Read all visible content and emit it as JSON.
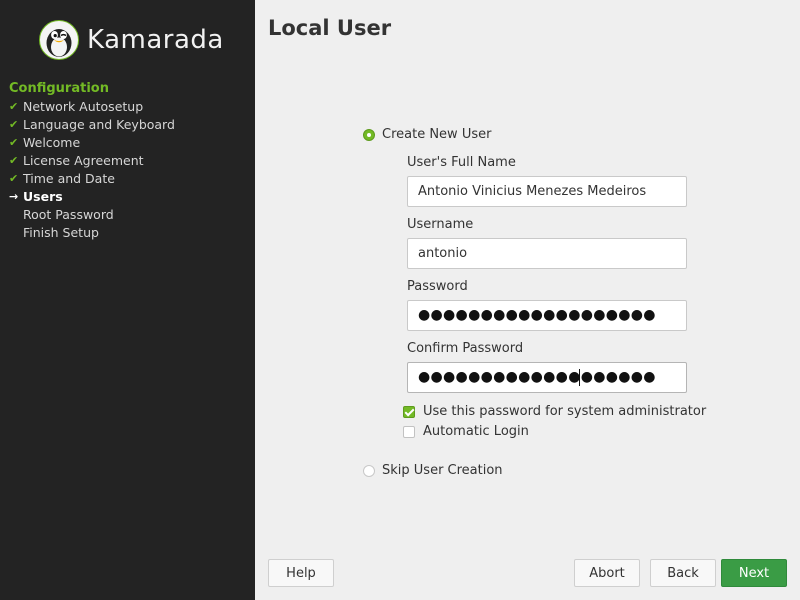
{
  "brand": {
    "name": "Kamarada"
  },
  "sidebar": {
    "title": "Configuration",
    "steps": [
      {
        "label": "Network Autosetup",
        "state": "done"
      },
      {
        "label": "Language and Keyboard",
        "state": "done"
      },
      {
        "label": "Welcome",
        "state": "done"
      },
      {
        "label": "License Agreement",
        "state": "done"
      },
      {
        "label": "Time and Date",
        "state": "done"
      },
      {
        "label": "Users",
        "state": "current"
      },
      {
        "label": "Root Password",
        "state": "pending"
      },
      {
        "label": "Finish Setup",
        "state": "pending"
      }
    ],
    "marks": {
      "done": "✔",
      "current": "→",
      "pending": ""
    }
  },
  "main": {
    "title": "Local User",
    "create_option": {
      "label": "Create New User",
      "selected": true
    },
    "fields": {
      "full_name": {
        "label": "User's Full Name",
        "value": "Antonio Vinicius Menezes Medeiros"
      },
      "username": {
        "label": "Username",
        "value": "antonio"
      },
      "password": {
        "label": "Password",
        "masked": "●●●●●●●●●●●●●●●●●●●"
      },
      "confirm_password": {
        "label": "Confirm Password",
        "masked": "●●●●●●●●●●●●●●●●●●●"
      }
    },
    "checkboxes": {
      "admin_password": {
        "label": "Use this password for system administrator",
        "checked": true
      },
      "auto_login": {
        "label": "Automatic Login",
        "checked": false
      }
    },
    "skip_option": {
      "label": "Skip User Creation",
      "selected": false
    }
  },
  "buttons": {
    "help": "Help",
    "abort": "Abort",
    "back": "Back",
    "next": "Next"
  },
  "colors": {
    "accent": "#73ba25",
    "primary_button": "#3a9c45",
    "sidebar_bg": "#232323",
    "content_bg": "#efefef"
  }
}
